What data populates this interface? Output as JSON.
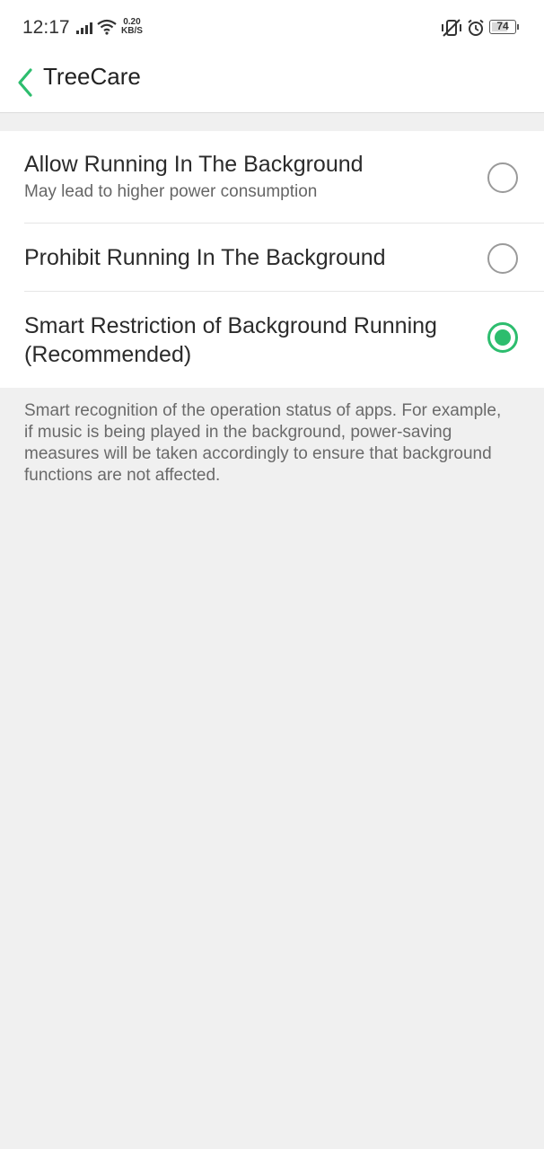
{
  "status_bar": {
    "time": "12:17",
    "net_speed_value": "0.20",
    "net_speed_unit": "KB/S",
    "battery_level": "74"
  },
  "app_bar": {
    "title": "TreeCare",
    "back_icon": "chevron-left-icon"
  },
  "options": [
    {
      "title": "Allow Running In The Background",
      "subtitle": "May lead to higher power consumption",
      "selected": false
    },
    {
      "title": "Prohibit Running In The Background",
      "selected": false
    },
    {
      "title": "Smart Restriction of Background Running (Recommended)",
      "selected": true
    }
  ],
  "description": "Smart recognition of the operation status of apps. For example, if music is being played in the background, power-saving measures will be taken accordingly to ensure that background functions are not affected.",
  "colors": {
    "accent": "#2dbd6e",
    "background": "#f0f0f0"
  }
}
